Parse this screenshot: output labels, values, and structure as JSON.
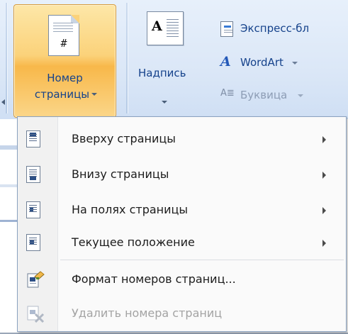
{
  "ribbon": {
    "page_number_button": {
      "line1": "Номер",
      "line2": "страницы",
      "glyph": "#",
      "icon": "page-number-icon"
    },
    "text_box_button": {
      "label": "Надпись",
      "glyph": "A",
      "icon": "text-box-icon"
    },
    "quick_parts": {
      "label": "Экспресс-бл",
      "icon": "quick-parts-icon"
    },
    "wordart": {
      "label": "WordArt",
      "icon": "wordart-icon"
    },
    "drop_cap": {
      "label": "Буквица",
      "icon": "drop-cap-icon"
    }
  },
  "menu": {
    "items": [
      {
        "label": "Вверху страницы",
        "has_submenu": true,
        "enabled": true,
        "icon": "page-top-icon"
      },
      {
        "label": "Внизу страницы",
        "has_submenu": true,
        "enabled": true,
        "icon": "page-bottom-icon"
      },
      {
        "label": "На полях страницы",
        "has_submenu": true,
        "enabled": true,
        "icon": "page-margins-icon"
      },
      {
        "label": "Текущее положение",
        "has_submenu": true,
        "enabled": true,
        "icon": "current-position-icon"
      },
      {
        "label": "Формат номеров страниц...",
        "has_submenu": false,
        "enabled": true,
        "icon": "format-page-numbers-icon"
      },
      {
        "label": "Удалить номера страниц",
        "has_submenu": false,
        "enabled": false,
        "icon": "remove-page-numbers-icon"
      }
    ]
  },
  "colors": {
    "ribbon_label": "#15428b",
    "active_button": "#fbd27a",
    "menu_text": "#1c1c1c",
    "disabled_text": "#a3a3a3"
  }
}
